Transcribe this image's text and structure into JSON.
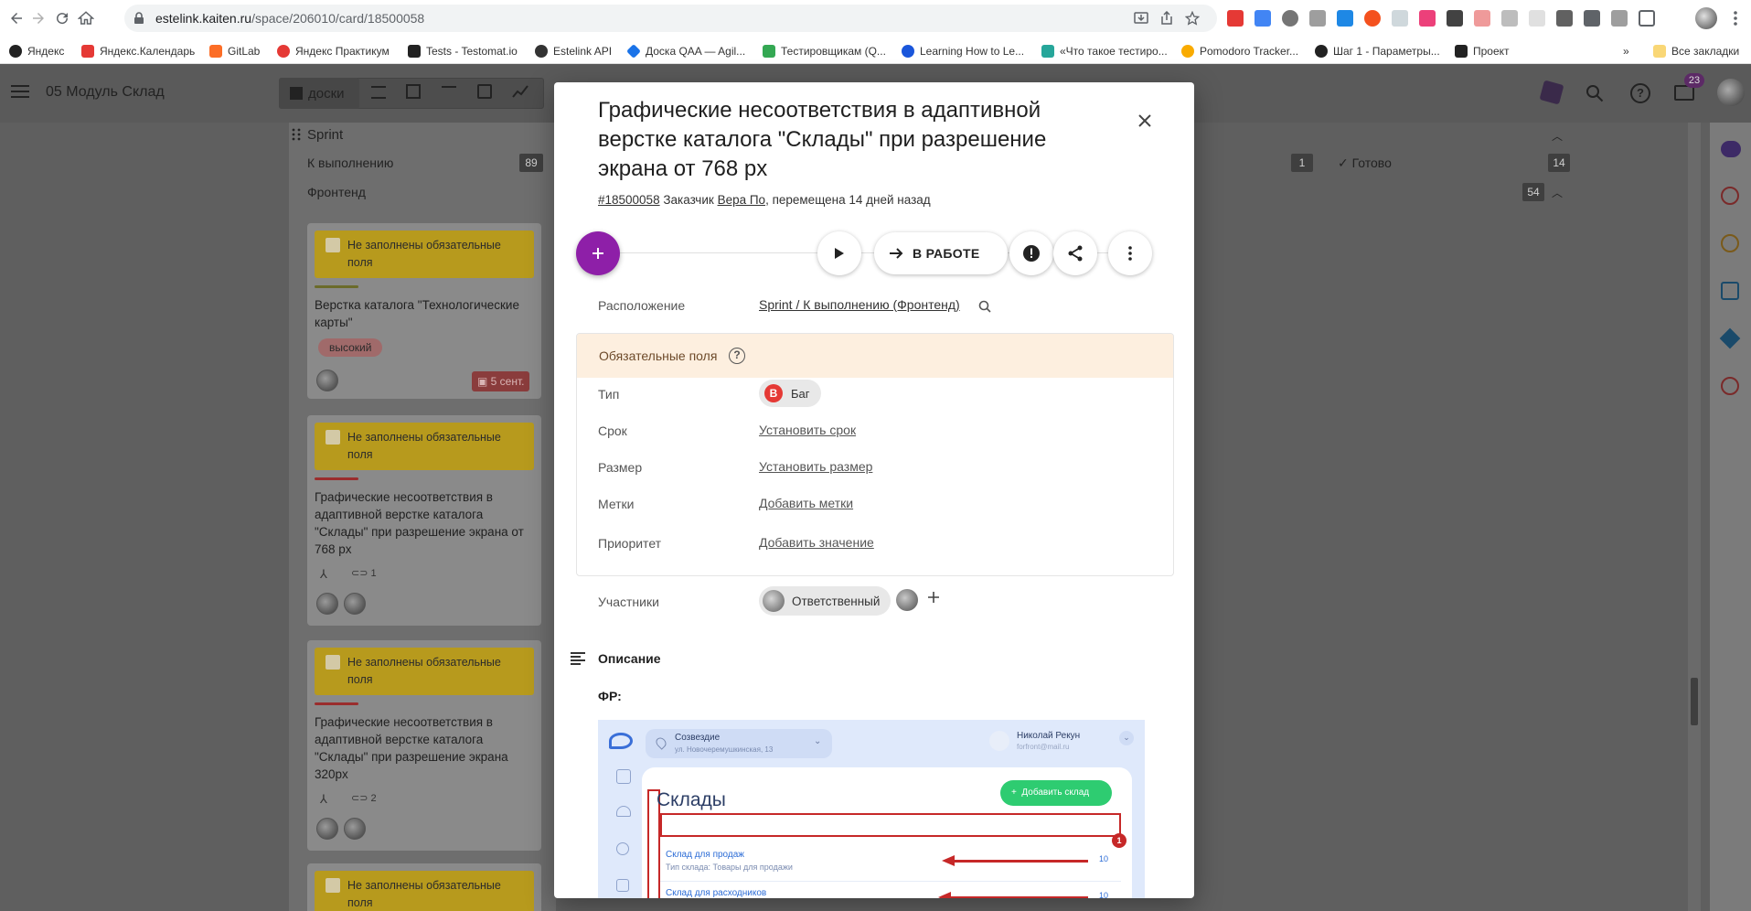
{
  "browser": {
    "url_host": "estelink.kaiten.ru",
    "url_path": "/space/206010/card/18500058",
    "bookmarks": [
      {
        "label": "Яндекс",
        "color": "#222222"
      },
      {
        "label": "Яндекс.Календарь",
        "color": "#e53935"
      },
      {
        "label": "GitLab",
        "color": "#fc6d26"
      },
      {
        "label": "Яндекс Практикум",
        "color": "#e53935"
      },
      {
        "label": "Tests - Testomat.io",
        "color": "#222222"
      },
      {
        "label": "Estelink API",
        "color": "#333333"
      },
      {
        "label": "Доска QAA — Agil...",
        "color": "#1a73e8"
      },
      {
        "label": "Тестировщикам (Q...",
        "color": "#34a853"
      },
      {
        "label": "Learning How to Le...",
        "color": "#1a56db"
      },
      {
        "label": "«Что такое тестиро...",
        "color": "#26a69a"
      },
      {
        "label": "Pomodoro Tracker...",
        "color": "#f9ab00"
      },
      {
        "label": "Шаг 1 - Параметры...",
        "color": "#222222"
      },
      {
        "label": "Проект",
        "color": "#222222"
      }
    ],
    "bookmarks_more": "»",
    "all_bookmarks": "Все закладки"
  },
  "app": {
    "space_title": "05 Модуль Склад",
    "view_tab": "доски",
    "notif_count": "23"
  },
  "board": {
    "sprint_label": "Sprint",
    "todo_label": "К выполнению",
    "todo_count": "89",
    "frontend_label": "Фронтенд",
    "mid_count": "1",
    "done_label": "Готово",
    "done_count": "14",
    "lane_count": "54",
    "cards": [
      {
        "warning": "Не заполнены обязательные поля",
        "title": "Верстка каталога \"Технологические карты\"",
        "priority": "высокий",
        "date": "5 сент.",
        "strip": "#7a7a2a"
      },
      {
        "warning": "Не заполнены обязательные поля",
        "title": "Графические несоответствия в адаптивной верстке каталога \"Склады\" при разрешение экрана от 768 px",
        "links": "1",
        "strip": "#b03030"
      },
      {
        "warning": "Не заполнены обязательные поля",
        "title": "Графические несоответствия в адаптивной верстке каталога \"Склады\" при разрешение экрана 320px",
        "links": "2",
        "strip": "#b03030"
      },
      {
        "warning": "Не заполнены обязательные поля"
      }
    ]
  },
  "modal": {
    "title": "Графические несоответствия в адаптивной верстке каталога \"Склады\" при разрешение экрана от 768 px",
    "card_id": "#18500058",
    "customer_label": "Заказчик",
    "customer_name": "Вера По",
    "moved_text": ", перемещена 14 дней назад",
    "status_button": "В РАБОТЕ",
    "location_label": "Расположение",
    "location_value": "Sprint / К выполнению (Фронтенд)",
    "required_label": "Обязательные поля",
    "fields": [
      {
        "label": "Тип",
        "value": "Баг",
        "badge": "B"
      },
      {
        "label": "Срок",
        "value": "Установить срок"
      },
      {
        "label": "Размер",
        "value": "Установить размер"
      },
      {
        "label": "Метки",
        "value": "Добавить метки"
      },
      {
        "label": "Приоритет",
        "value": "Добавить значение"
      }
    ],
    "participants_label": "Участники",
    "responsible_label": "Ответственный",
    "description_label": "Описание",
    "fr_label": "ФР:",
    "embedded": {
      "location_name": "Созвездие",
      "location_addr": "ул. Новочеремушкинская, 13",
      "user_name": "Николай Рекун",
      "user_email": "forfront@mail.ru",
      "page_title": "Склады",
      "add_button": "Добавить склад",
      "rows": [
        {
          "name": "Склад для продаж",
          "sub": "Тип склада: Товары для продажи",
          "num": "10"
        },
        {
          "name": "Склад для расходников",
          "sub": "",
          "num": "10"
        }
      ],
      "marker": "1"
    }
  },
  "colors": {
    "accent": "#8e1fa8",
    "bug": "#e53935",
    "warning": "#b79a1d",
    "req_bg": "#fdefdf"
  }
}
